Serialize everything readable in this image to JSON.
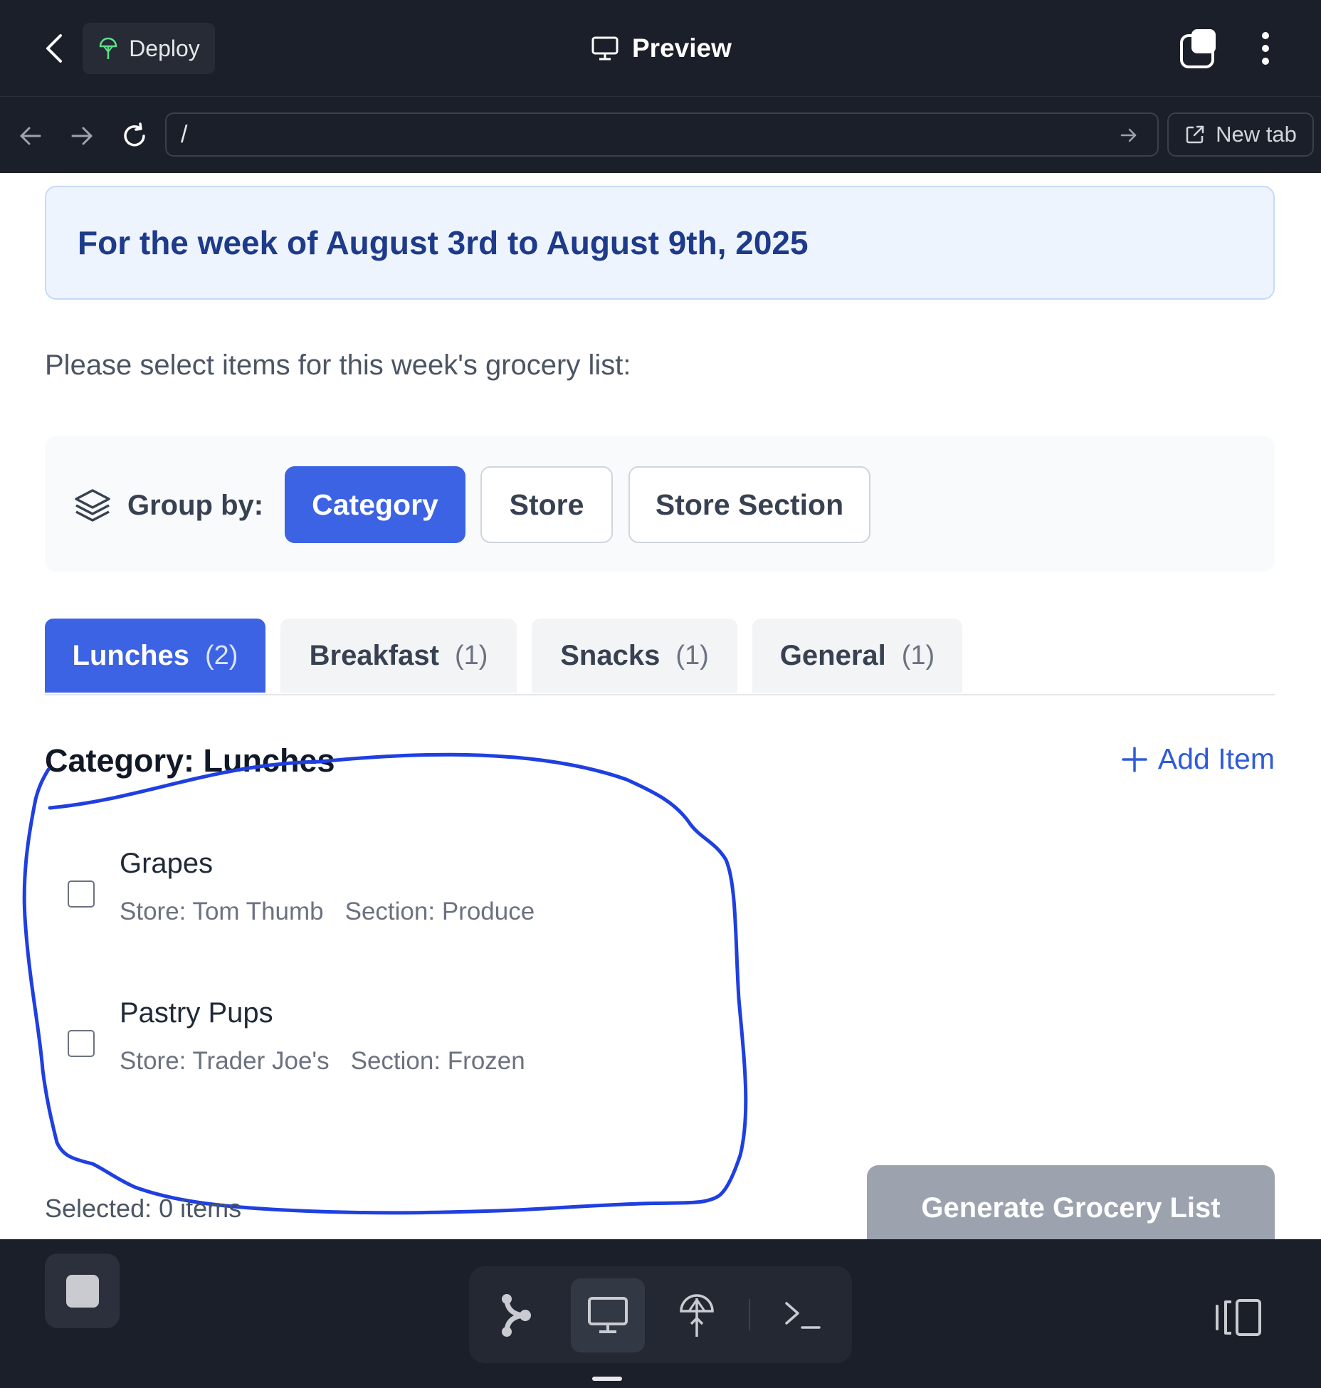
{
  "topbar": {
    "deploy_label": "Deploy",
    "title": "Preview"
  },
  "browser": {
    "url_value": "/",
    "new_tab_label": "New tab"
  },
  "page": {
    "week_banner": "For the week of August 3rd to August 9th, 2025",
    "instructions": "Please select items for this week's grocery list:",
    "group_by": {
      "label": "Group by:",
      "options": [
        "Category",
        "Store",
        "Store Section"
      ],
      "selected": "Category"
    },
    "category_tabs": [
      {
        "label": "Lunches",
        "count": "(2)"
      },
      {
        "label": "Breakfast",
        "count": "(1)"
      },
      {
        "label": "Snacks",
        "count": "(1)"
      },
      {
        "label": "General",
        "count": "(1)"
      }
    ],
    "section_title": "Category: Lunches",
    "add_item_label": "Add Item",
    "items": [
      {
        "name": "Grapes",
        "store": "Store: Tom Thumb",
        "section": "Section: Produce"
      },
      {
        "name": "Pastry Pups",
        "store": "Store: Trader Joe's",
        "section": "Section: Frozen"
      }
    ],
    "selected_count": "Selected: 0 items",
    "generate_label": "Generate Grocery List"
  },
  "colors": {
    "accent": "#3b63e3",
    "annotation_stroke": "#1f3fe0",
    "chrome_bg": "#1b1f29",
    "deploy_icon": "#5ee08a"
  },
  "icons": {
    "back": "chevron-left-icon",
    "deploy": "deploy-tree-icon",
    "preview": "monitor-icon",
    "tabs": "tabs-icon",
    "more": "more-vertical-icon",
    "nav_back": "arrow-left-icon",
    "nav_forward": "arrow-right-icon",
    "reload": "reload-icon",
    "go": "arrow-right-icon",
    "new_tab": "external-link-icon",
    "group_by": "layers-icon",
    "add": "plus-icon",
    "dock": [
      "stop-icon",
      "git-branch-icon",
      "monitor-icon",
      "deploy-icon",
      "terminal-icon",
      "panel-toggle-icon"
    ]
  }
}
